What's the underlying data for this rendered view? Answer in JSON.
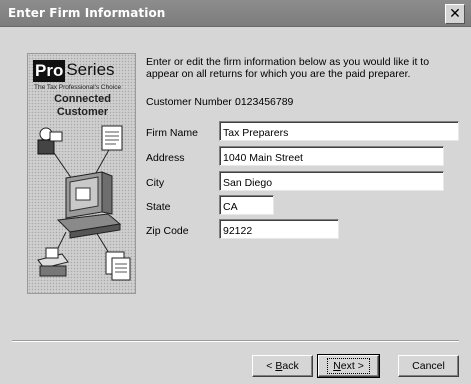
{
  "window": {
    "title": "Enter Firm Information",
    "close_glyph": "✕"
  },
  "sidebar": {
    "logo_pro": "Pro",
    "logo_series": "Series",
    "tagline": "The Tax Professional's Choice",
    "brand_line1": "Connected",
    "brand_line2": "Customer",
    "illustration": "computer-network-illustration"
  },
  "intro": "Enter or edit the firm information below as you would like it to appear on all returns for which you are the paid preparer.",
  "customer": {
    "label": "Customer Number :",
    "value": "0123456789"
  },
  "fields": {
    "firm_name": {
      "label": "Firm Name",
      "value": "Tax Preparers"
    },
    "address": {
      "label": "Address",
      "value": "1040 Main Street"
    },
    "city": {
      "label": "City",
      "value": "San Diego"
    },
    "state": {
      "label": "State",
      "value": "CA"
    },
    "zip": {
      "label": "Zip Code",
      "value": "92122"
    }
  },
  "buttons": {
    "back": {
      "pre": "< ",
      "accel": "B",
      "post": "ack"
    },
    "next": {
      "accel": "N",
      "post": "ext >"
    },
    "cancel": {
      "label": "Cancel"
    }
  }
}
